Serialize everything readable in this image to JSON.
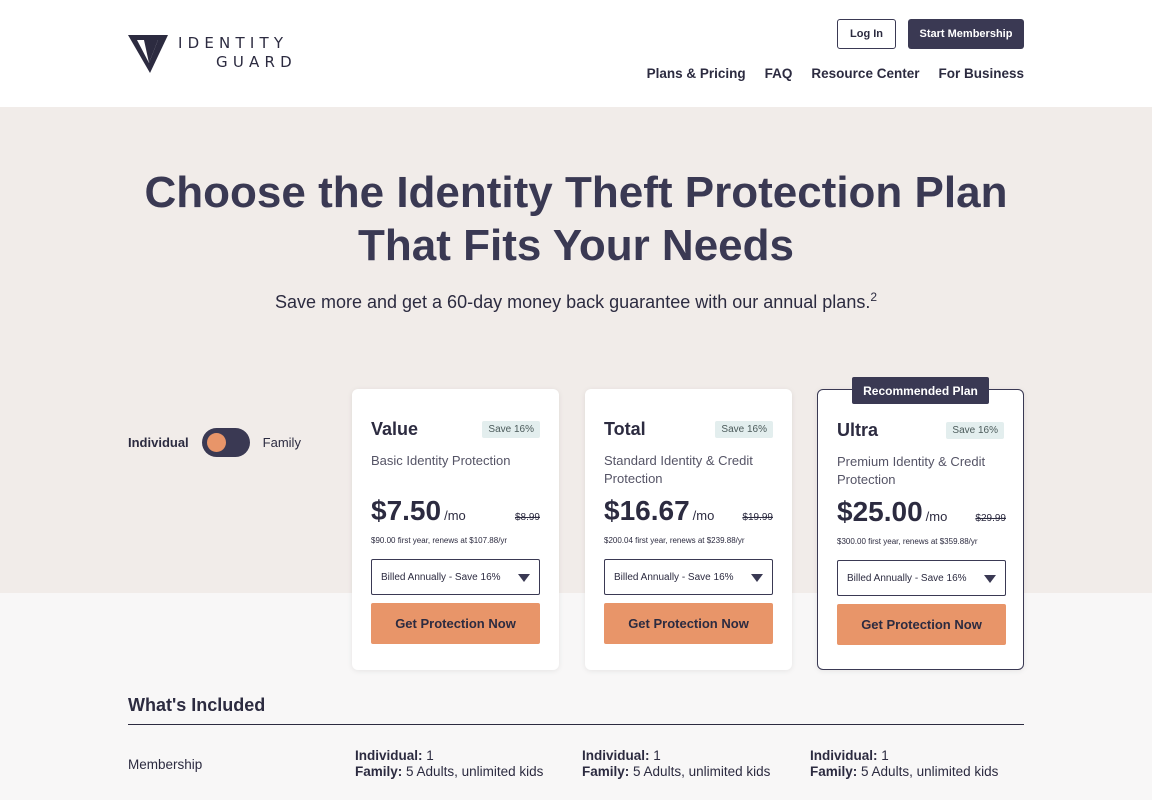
{
  "brand": {
    "name_line1": "IDENTITY",
    "name_line2": "GUARD"
  },
  "header": {
    "login_label": "Log In",
    "start_label": "Start Membership"
  },
  "nav": {
    "items": [
      "Plans & Pricing",
      "FAQ",
      "Resource Center",
      "For Business"
    ]
  },
  "hero": {
    "title_line1": "Choose the Identity Theft Protection Plan",
    "title_line2": "That Fits Your Needs",
    "subtitle": "Save more and get a 60-day money back guarantee with our annual plans.",
    "subtitle_sup": "2"
  },
  "toggle": {
    "left_label": "Individual",
    "right_label": "Family",
    "selected": "Individual"
  },
  "recommended_label": "Recommended Plan",
  "plans": [
    {
      "name": "Value",
      "save": "Save 16%",
      "description": "Basic Identity Protection",
      "price": "$7.50",
      "per": "/mo",
      "old_price": "$8.99",
      "renew": "$90.00 first year, renews at $107.88/yr",
      "billing": "Billed Annually - Save 16%",
      "cta": "Get Protection Now"
    },
    {
      "name": "Total",
      "save": "Save 16%",
      "description": "Standard Identity & Credit Protection",
      "price": "$16.67",
      "per": "/mo",
      "old_price": "$19.99",
      "renew": "$200.04 first year, renews at $239.88/yr",
      "billing": "Billed Annually - Save 16%",
      "cta": "Get Protection Now"
    },
    {
      "name": "Ultra",
      "save": "Save 16%",
      "description": "Premium Identity & Credit Protection",
      "price": "$25.00",
      "per": "/mo",
      "old_price": "$29.99",
      "renew": "$300.00 first year, renews at $359.88/yr",
      "billing": "Billed Annually - Save 16%",
      "cta": "Get Protection Now"
    }
  ],
  "included": {
    "title": "What's Included",
    "rows": [
      {
        "label": "Membership",
        "cells": [
          {
            "ind_label": "Individual:",
            "ind_value": "1",
            "fam_label": "Family:",
            "fam_value": "5 Adults, unlimited kids"
          },
          {
            "ind_label": "Individual:",
            "ind_value": "1",
            "fam_label": "Family:",
            "fam_value": "5 Adults, unlimited kids"
          },
          {
            "ind_label": "Individual:",
            "ind_value": "1",
            "fam_label": "Family:",
            "fam_value": "5 Adults, unlimited kids"
          }
        ]
      }
    ]
  },
  "colors": {
    "primary": "#3a3953",
    "accent": "#e89569",
    "hero_bg": "#f1ece9",
    "badge_bg": "#e3eeee"
  }
}
